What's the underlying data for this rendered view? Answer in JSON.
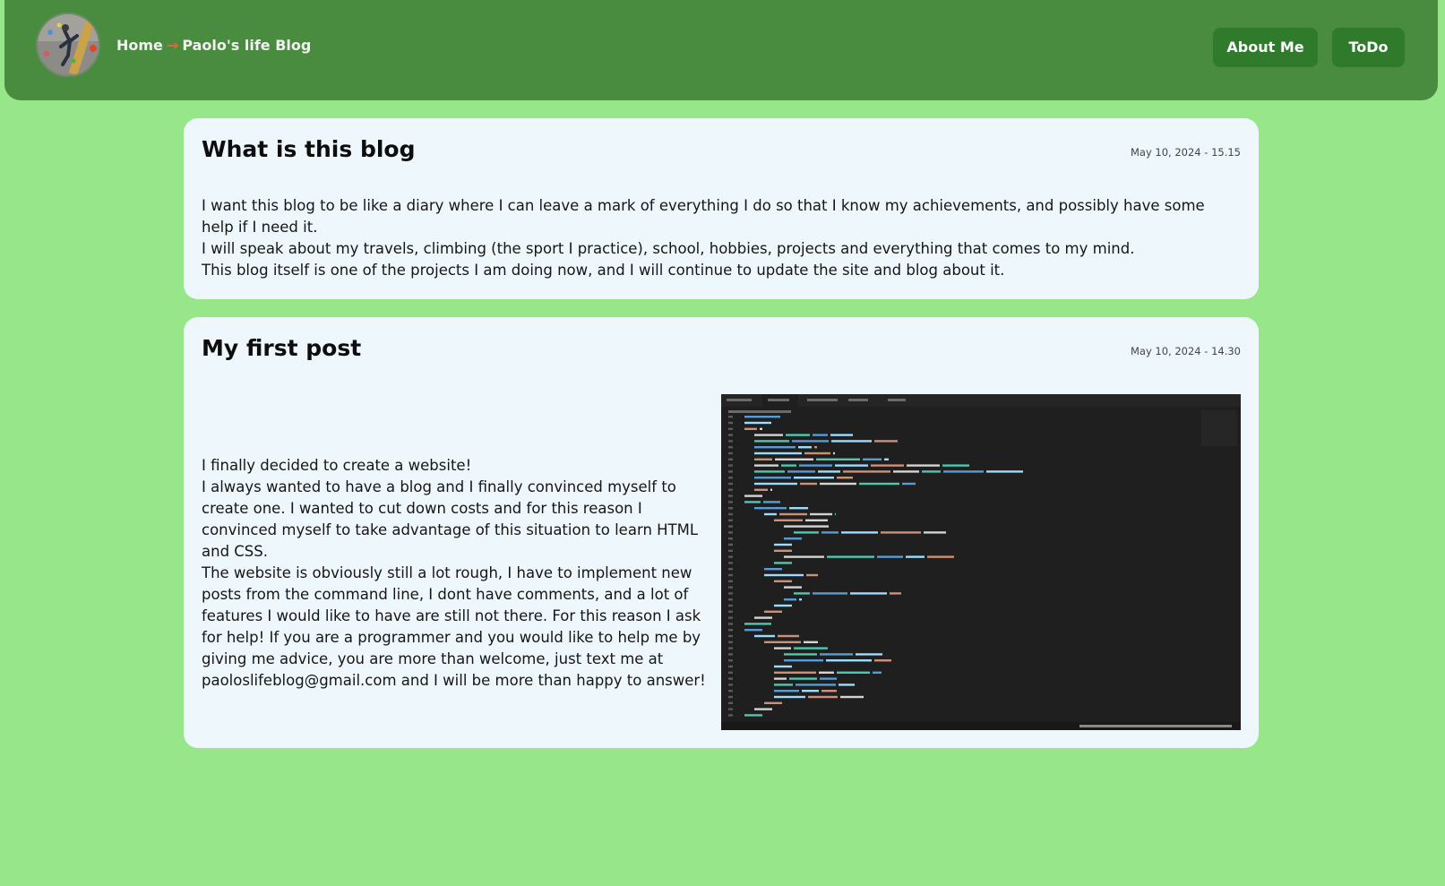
{
  "header": {
    "home_label": "Home",
    "separator": "→",
    "page_name": "Paolo's life Blog",
    "nav": [
      {
        "label": "About Me"
      },
      {
        "label": "ToDo"
      }
    ]
  },
  "posts": [
    {
      "title": "What is this blog",
      "date": "May 10, 2024 - 15.15",
      "paragraphs": [
        "I want this blog to be like a diary where I can leave a mark of everything I do so that I know my achievements, and possibly have some help if I need it.",
        "I will speak about my travels, climbing (the sport I practice), school, hobbies, projects and everything that comes to my mind.",
        "This blog itself is one of the projects I am doing now, and I will continue to update the site and blog about it."
      ]
    },
    {
      "title": "My first post",
      "date": "May 10, 2024 - 14.30",
      "paragraphs": [
        "I finally decided to create a website!",
        "I always wanted to have a blog and I finally convinced myself to create one. I wanted to cut down costs and for this reason I convinced myself to take advantage of this situation to learn HTML and CSS.",
        "The website is obviously still a lot rough, I have to implement new posts from the command line, I dont have comments, and a lot of features I would like to have are still not there. For this reason I ask for help! If you are a programmer and you would like to help me by giving me advice, you are more than welcome, just text me at paoloslifeblog@gmail.com and I will be more than happy to answer!"
      ],
      "image_alt": "code-editor-screenshot"
    }
  ],
  "colors": {
    "page_bg": "#97e78a",
    "navbar_bg": "#4a8c3f",
    "nav_button_bg": "#2f7a2b",
    "card_bg": "#eef7fc",
    "separator": "#e06a3a"
  }
}
